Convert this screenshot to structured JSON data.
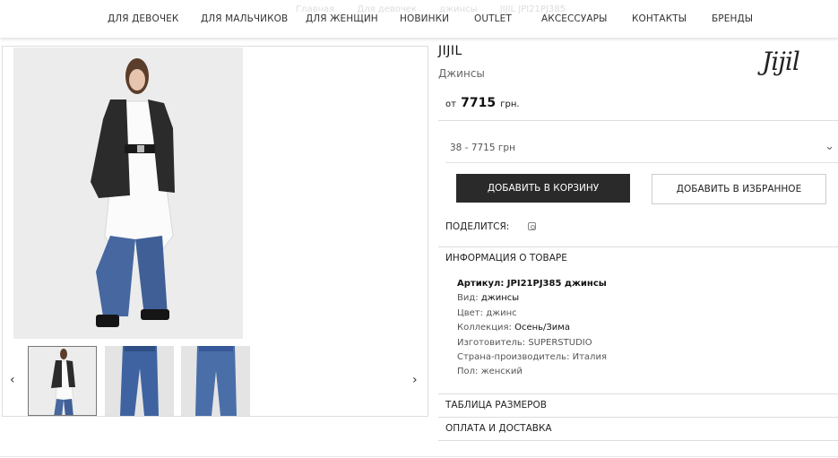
{
  "breadcrumb": [
    "Главная",
    "Для девочек",
    "джинсы",
    "JIJIL JPI21PJ385"
  ],
  "nav": [
    "ДЛЯ ДЕВОЧЕК",
    "ДЛЯ МАЛЬЧИКОВ",
    "ДЛЯ ЖЕНЩИН",
    "НОВИНКИ",
    "OUTLET",
    "АКСЕССУАРЫ",
    "КОНТАКТЫ",
    "БРЕНДЫ"
  ],
  "product": {
    "brand": "JIJIL",
    "logo_text": "Jijil",
    "category": "Джинсы",
    "price_prefix": "от",
    "price": "7715",
    "currency": "грн.",
    "size_option": "38 - 7715 грн"
  },
  "buttons": {
    "add_to_cart": "ДОБАВИТЬ В КОРЗИНУ",
    "add_to_favorites": "ДОБАВИТЬ В ИЗБРАННОЕ"
  },
  "share_label": "ПОДЕЛИТСЯ:",
  "info": {
    "title": "ИНФОРМАЦИЯ О ТОВАРЕ",
    "article": "Артикул: JPI21PJ385 джинсы",
    "type_label": "Вид:",
    "type": "джинсы",
    "color_label": "Цвет:",
    "color": "джинс",
    "collection_label": "Коллекция:",
    "collection": "Осень/Зима",
    "maker_label": "Изготовитель:",
    "maker": "SUPERSTUDIO",
    "country_label": "Страна-производитель:",
    "country": "Италия",
    "gender_label": "Пол:",
    "gender": "женский"
  },
  "size_table": "ТАБЛИЦА РАЗМЕРОВ",
  "payment": "ОПЛАТА И ДОСТАВКА",
  "icons": {
    "prev": "chevron-left-icon",
    "next": "chevron-right-icon",
    "dropdown": "chevron-down-icon",
    "share": "instagram-icon"
  }
}
